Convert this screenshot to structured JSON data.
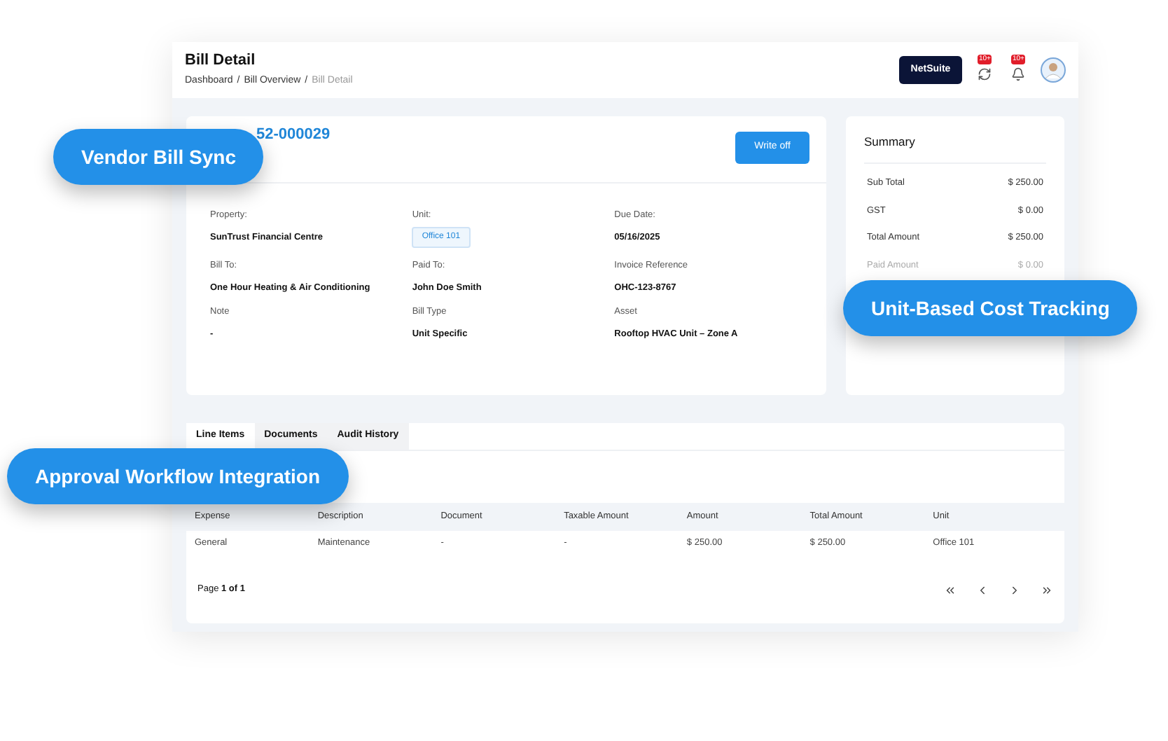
{
  "header": {
    "title": "Bill Detail",
    "breadcrumb_separator": "/",
    "breadcrumbs": [
      {
        "label": "Dashboard",
        "current": false
      },
      {
        "label": "Bill Overview",
        "current": false
      },
      {
        "label": "Bill Detail",
        "current": true
      }
    ],
    "netsuite_button": "NetSuite",
    "notifications": [
      {
        "kind": "sync",
        "count": "10+"
      },
      {
        "kind": "bell",
        "count": "10+"
      }
    ]
  },
  "bill": {
    "number": "52-000029",
    "write_off_button": "Write off",
    "fields": [
      {
        "label": "Property:",
        "value": "SunTrust Financial Centre",
        "kind": "text"
      },
      {
        "label": "Unit:",
        "value": "Office 101",
        "kind": "tag"
      },
      {
        "label": "Due Date:",
        "value": "05/16/2025",
        "kind": "text"
      },
      {
        "label": "Bill To:",
        "value": "One Hour Heating & Air Conditioning",
        "kind": "text"
      },
      {
        "label": "Paid To:",
        "value": "John Doe Smith",
        "kind": "text"
      },
      {
        "label": "Invoice Reference",
        "value": "OHC-123-8767",
        "kind": "text"
      },
      {
        "label": "Note",
        "value": "-",
        "kind": "text"
      },
      {
        "label": "Bill Type",
        "value": "Unit Specific",
        "kind": "text"
      },
      {
        "label": "Asset",
        "value": "Rooftop HVAC Unit – Zone A",
        "kind": "text"
      }
    ]
  },
  "summary": {
    "title": "Summary",
    "rows": [
      {
        "label": "Sub Total",
        "value": "$ 250.00",
        "muted": false
      },
      {
        "label": "GST",
        "value": "$ 0.00",
        "muted": false
      },
      {
        "label": "Total Amount",
        "value": "$ 250.00",
        "muted": false
      },
      {
        "label": "Paid Amount",
        "value": "$ 0.00",
        "muted": true
      }
    ]
  },
  "tabs": [
    {
      "label": "Line Items",
      "selected": true
    },
    {
      "label": "Documents",
      "selected": false
    },
    {
      "label": "Audit History",
      "selected": false
    }
  ],
  "table": {
    "columns": [
      "Expense",
      "Description",
      "Document",
      "Taxable Amount",
      "Amount",
      "Total Amount",
      "Unit"
    ],
    "rows": [
      [
        "General",
        "Maintenance",
        "-",
        "-",
        "$ 250.00",
        "$ 250.00",
        "Office 101"
      ]
    ]
  },
  "pagination": {
    "text": "Page **1 of 1**"
  },
  "callouts": [
    {
      "label": "Vendor Bill Sync"
    },
    {
      "label": "Unit-Based Cost Tracking"
    },
    {
      "label": "Approval Workflow Integration"
    }
  ]
}
